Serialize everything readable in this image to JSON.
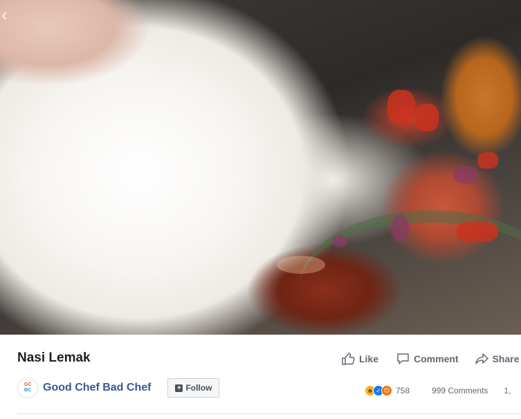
{
  "post": {
    "title": "Nasi Lemak"
  },
  "actions": {
    "like_label": "Like",
    "comment_label": "Comment",
    "share_label": "Share"
  },
  "page": {
    "name": "Good Chef Bad Chef",
    "avatar_text_top": "GC",
    "avatar_text_bottom": "BC",
    "follow_label": "Follow"
  },
  "stats": {
    "reactions_count": "758",
    "comments": "999 Comments",
    "shares_partial": "1,"
  },
  "icons": {
    "prev": "chevron-left-icon",
    "like": "thumbs-up-icon",
    "comment": "speech-bubble-icon",
    "share": "share-arrow-icon",
    "follow": "plus-icon",
    "reactions": [
      "haha-reaction-icon",
      "like-reaction-icon",
      "angry-reaction-icon"
    ]
  },
  "colors": {
    "link": "#385898",
    "muted": "#606770",
    "like_blue": "#1877f2"
  }
}
